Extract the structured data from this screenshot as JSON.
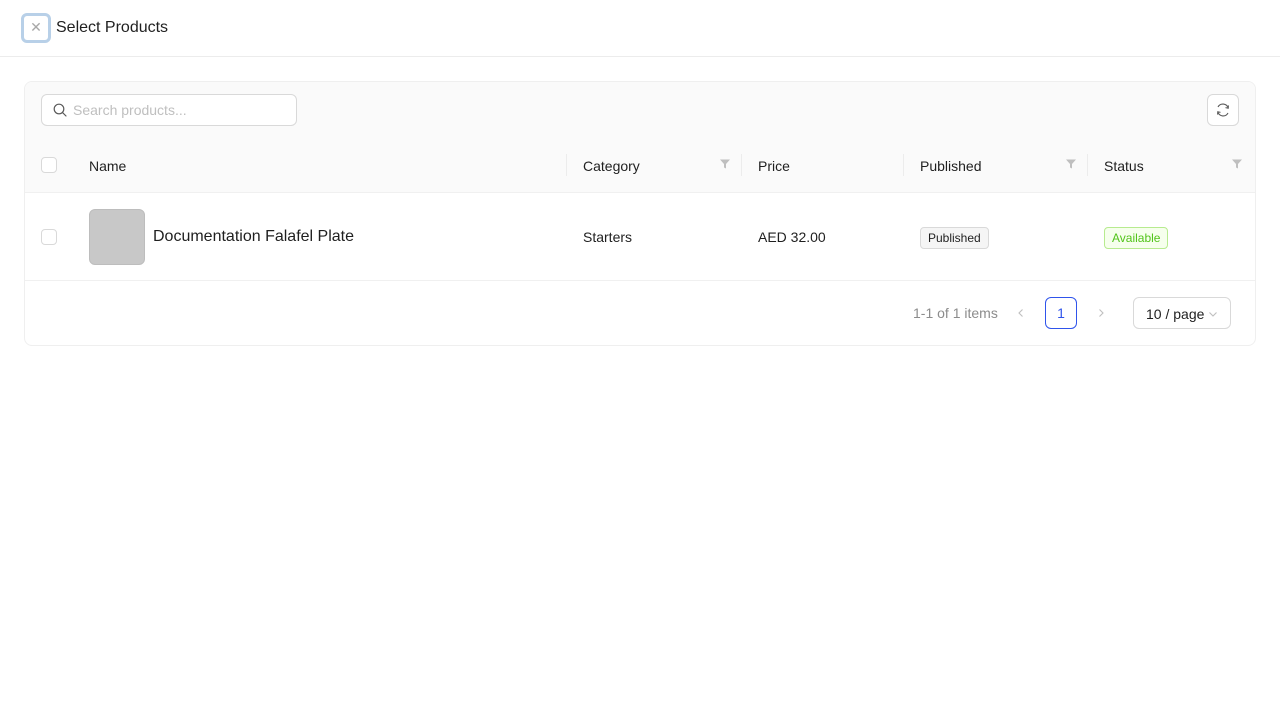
{
  "header": {
    "title": "Select Products",
    "close_icon": "close-icon"
  },
  "toolbar": {
    "search_placeholder": "Search products...",
    "search_value": "",
    "reload_icon": "reload-icon"
  },
  "table": {
    "columns": [
      {
        "label": "Name",
        "filterable": false
      },
      {
        "label": "Category",
        "filterable": true
      },
      {
        "label": "Price",
        "filterable": false
      },
      {
        "label": "Published",
        "filterable": true
      },
      {
        "label": "Status",
        "filterable": true
      }
    ],
    "rows": [
      {
        "name": "Documentation Falafel Plate",
        "category": "Starters",
        "price": "AED 32.00",
        "published": "Published",
        "status": "Available"
      }
    ]
  },
  "pagination": {
    "total_text": "1-1 of 1 items",
    "current_page": "1",
    "page_size": "10 / page"
  },
  "colors": {
    "accent": "#2f54eb",
    "status_available": "#52c41a",
    "status_available_bg": "#f6ffed"
  }
}
